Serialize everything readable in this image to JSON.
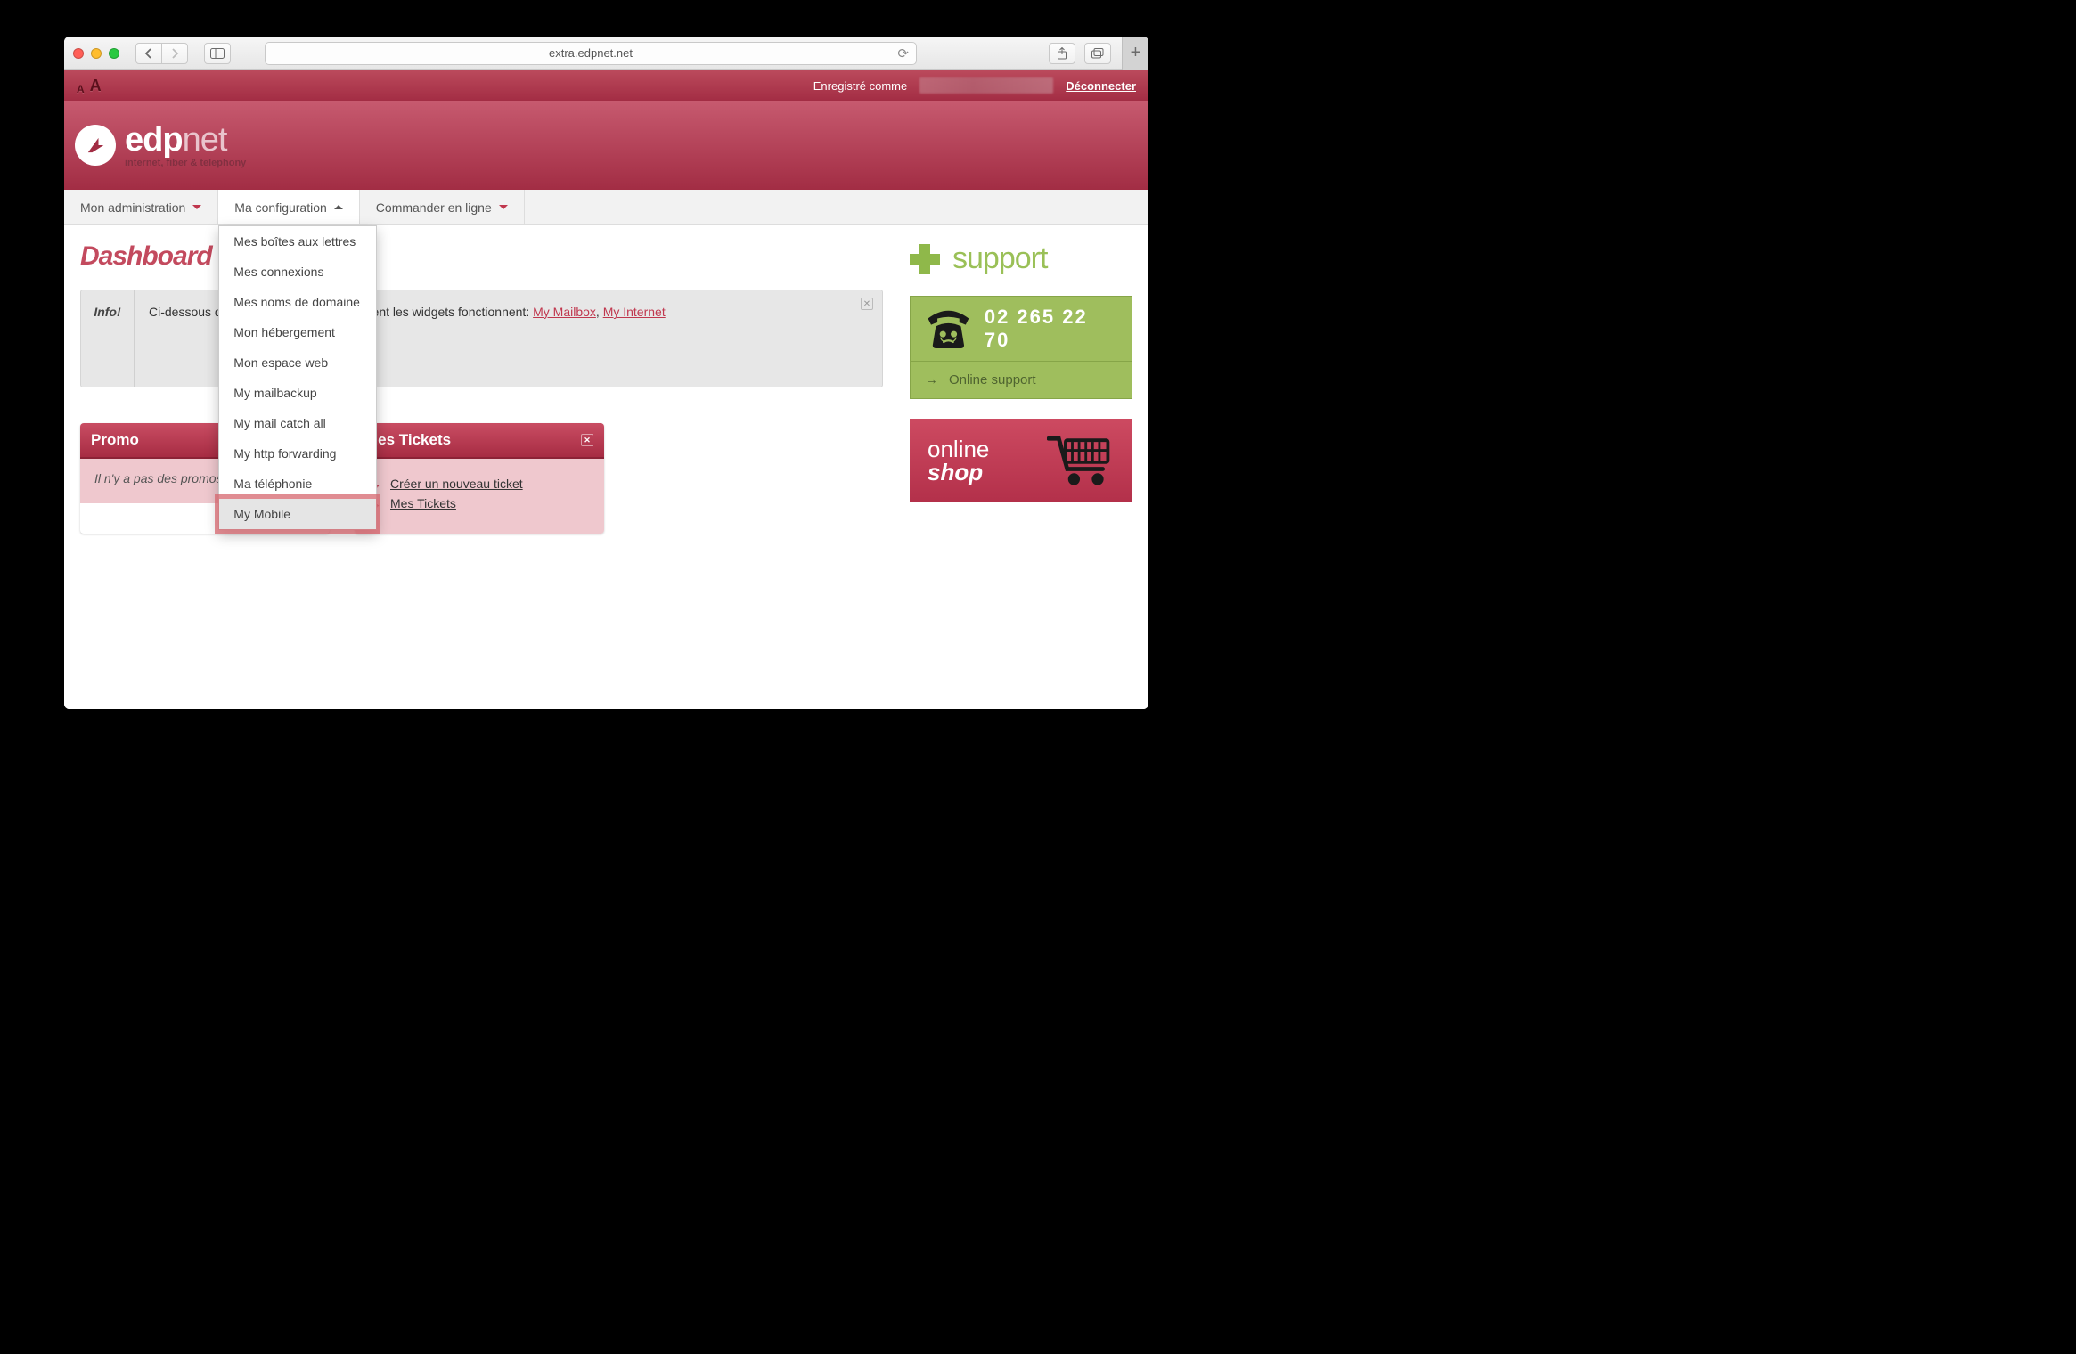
{
  "browser": {
    "url": "extra.edpnet.net"
  },
  "header": {
    "logged_in_prefix": "Enregistré comme",
    "logout": "Déconnecter",
    "brand_bold": "edp",
    "brand_light": "net",
    "tagline": "internet, fiber & telephony"
  },
  "nav": {
    "admin": "Mon administration",
    "config": "Ma configuration",
    "order": "Commander en ligne"
  },
  "dropdown": {
    "items": [
      "Mes boîtes aux lettres",
      "Mes connexions",
      "Mes noms de domaine",
      "Mon hébergement",
      "Mon espace web",
      "My mailbackup",
      "My mail catch all",
      "My http forwarding",
      "Ma téléphonie",
      "My Mobile"
    ]
  },
  "page": {
    "title": "Dashboard",
    "info_label": "Info!",
    "info_text_pre": "Ci-dessous quelques petits filmes comment les widgets fonctionnent: ",
    "info_link1": "My Mailbox",
    "info_sep": ", ",
    "info_link2": "My Internet"
  },
  "widgets": {
    "promo": {
      "title": "Promo",
      "body": "Il n'y a pas des promos."
    },
    "tickets": {
      "title": "Mes Tickets",
      "link1": "Créer un nouveau ticket",
      "link2": "Mes Tickets"
    }
  },
  "sidebar": {
    "support_label": "support",
    "phone": "02 265 22 70",
    "online_support": "Online support",
    "shop_line1": "online",
    "shop_line2": "shop"
  }
}
